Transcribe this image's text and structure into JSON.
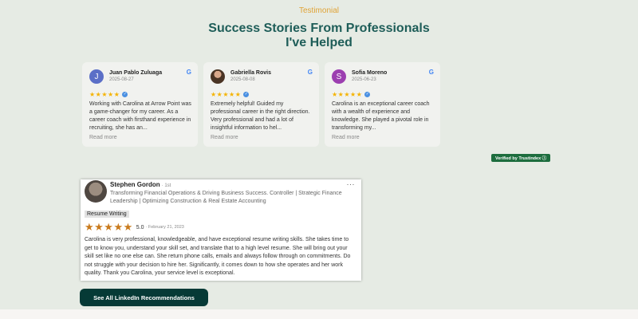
{
  "section": {
    "eyebrow": "Testimonial",
    "heading_line1": "Success Stories From Professionals",
    "heading_line2": "I've Helped"
  },
  "google_reviews": [
    {
      "initial": "J",
      "avatar_color": "#5b6fc7",
      "name": "Juan Pablo Zuluaga",
      "date": "2025-08-27",
      "stars": "★★★★★",
      "text": "Working with Carolina at Arrow Point was a game-changer for my career. As a career coach with firsthand experience in recruiting, she has an...",
      "read_more": "Read more",
      "source_icon": "google-icon"
    },
    {
      "initial": "",
      "avatar_color": "#6a4a34",
      "name": "Gabriella Rovis",
      "date": "2025-08-08",
      "stars": "★★★★★",
      "text": "Extremely helpful! Guided my professional career in the right direction. Very professional and had a lot of insightful information to hel...",
      "read_more": "Read more",
      "source_icon": "google-icon"
    },
    {
      "initial": "S",
      "avatar_color": "#9c3fb0",
      "name": "Sofia Moreno",
      "date": "2025-06-23",
      "stars": "★★★★★",
      "text": "Carolina is an exceptional career coach with a wealth of experience and knowledge. She played a pivotal role in transforming my...",
      "read_more": "Read more",
      "source_icon": "google-icon"
    }
  ],
  "verified_badge": "Verified by Trustindex ⓘ",
  "linkedin_review": {
    "name": "Stephen Gordon",
    "degree": "· 1st",
    "headline": "Transforming Financial Operations & Driving Business Success. Controller | Strategic Finance Leadership | Optimizing Construction & Real Estate Accounting",
    "more": "···",
    "tag": "Resume Writing",
    "stars": "★★★★★",
    "score": "5.0",
    "date": "· February 21, 2023",
    "text": "Carolina is very professional, knowledgeable, and have exceptional resume writing skills. She takes time to get to know you, understand your skill set, and translate that to a high level resume. She will bring out your skill set like no one else can. She return phone calls, emails and always follow through on commitments. Do not struggle with your decision to hire her. Significantly, it comes down to how she operates and her work quality. Thank you Carolina, your service level is exceptional."
  },
  "cta_label": "See All LinkedIn Recommendations",
  "colors": {
    "background": "#e6ebe4",
    "heading": "#1e5d58",
    "eyebrow": "#e0a336",
    "cta": "#063a36",
    "verified": "#1d6d3e",
    "star": "#f5b301"
  }
}
